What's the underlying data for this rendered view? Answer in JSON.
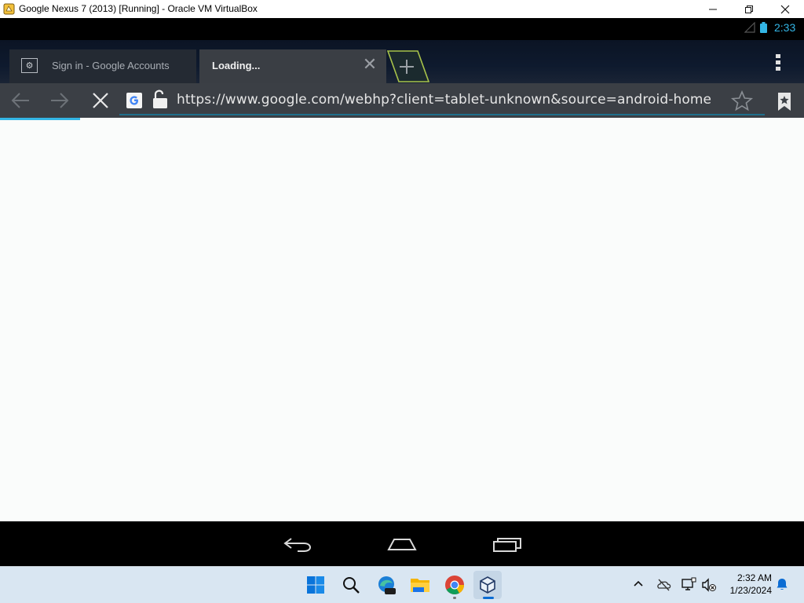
{
  "window": {
    "title": "Google Nexus 7 (2013) [Running] - Oracle VM VirtualBox",
    "min_glyph": "—",
    "restore_glyph": "❐",
    "close_glyph": "✕"
  },
  "android": {
    "status_clock": "2:33",
    "tabs": [
      {
        "title": "Sign in - Google Accounts",
        "active": false,
        "favicon": "google-accounts-icon"
      },
      {
        "title": "Loading...",
        "active": true,
        "favicon": null
      }
    ],
    "tab_close_glyph": "✕",
    "url": "https://www.google.com/webhp?client=tablet-unknown&source=android-home",
    "page_load_progress": 0.1,
    "accent_color": "#33b5e5"
  },
  "taskbar": {
    "apps": [
      "start-icon",
      "search-icon",
      "edge-icon",
      "file-explorer-icon",
      "chrome-icon",
      "virtualbox-icon"
    ],
    "clock_time": "2:32 AM",
    "clock_date": "1/23/2024"
  }
}
